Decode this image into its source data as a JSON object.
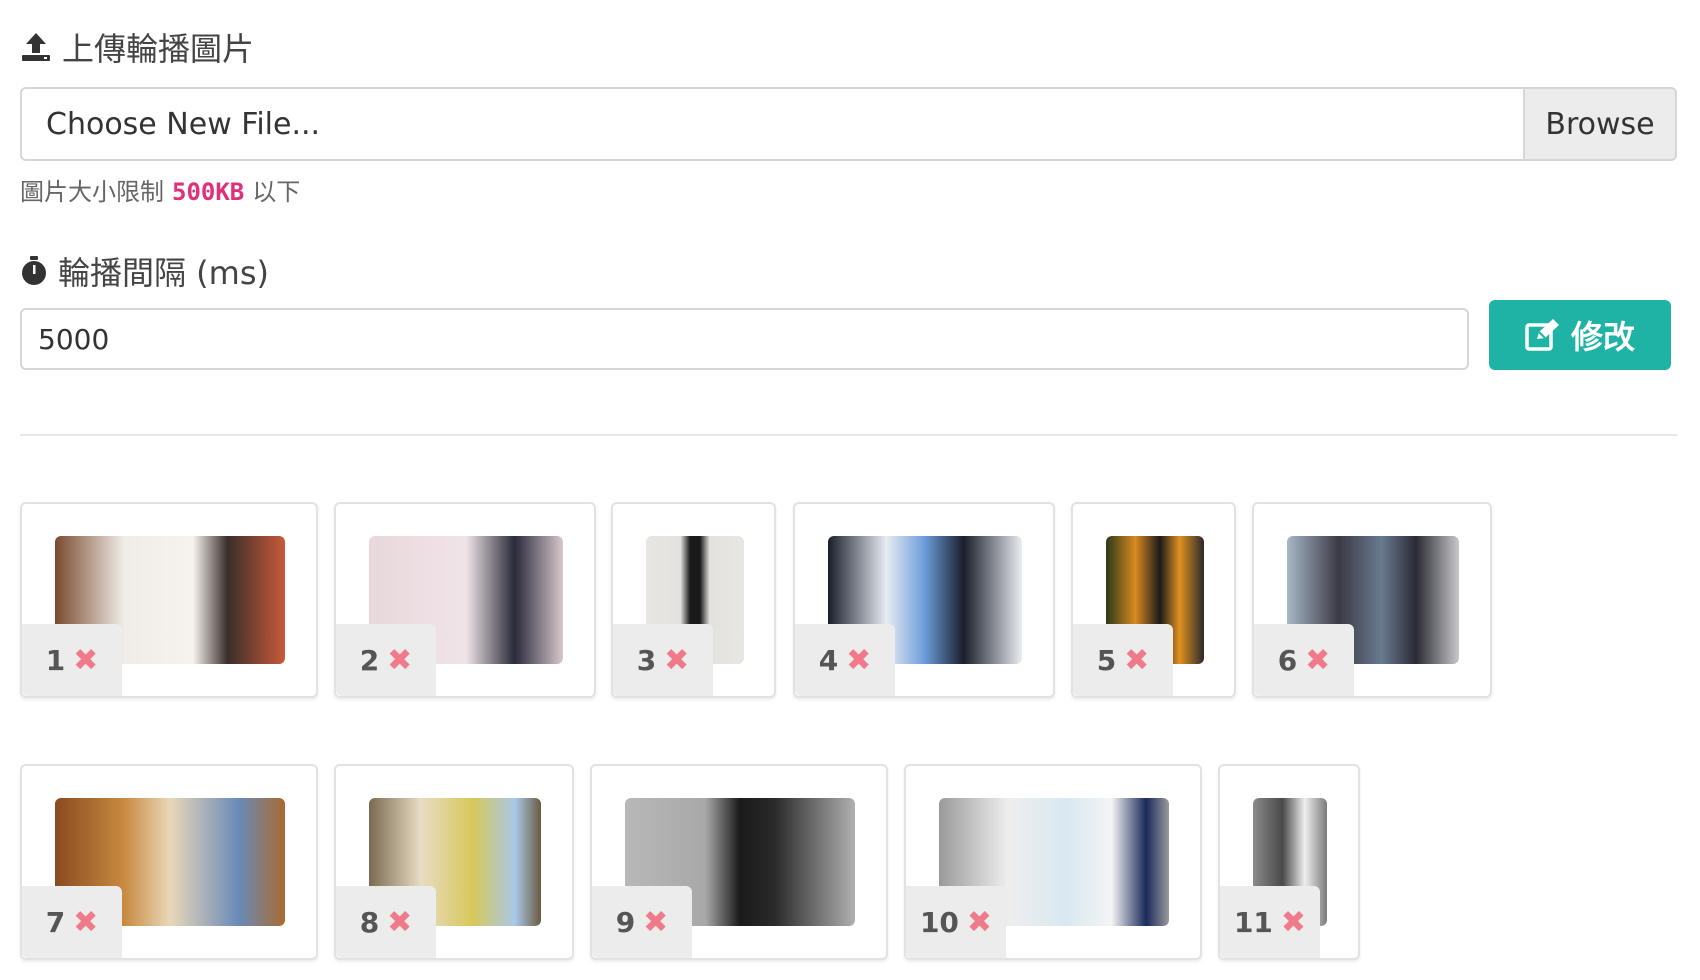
{
  "upload": {
    "title": "上傳輪播圖片",
    "icon": "upload-icon",
    "file_placeholder": "Choose New File...",
    "browse_label": "Browse",
    "help_prefix": "圖片大小限制",
    "help_limit": "500KB",
    "help_suffix": "以下"
  },
  "interval": {
    "title": "輪播間隔 (ms)",
    "icon": "stopwatch-icon",
    "value": "5000",
    "submit_label": "修改",
    "submit_icon": "edit-icon",
    "accent_color": "#1fb3a5"
  },
  "slides": [
    {
      "index": "1"
    },
    {
      "index": "2"
    },
    {
      "index": "3"
    },
    {
      "index": "4"
    },
    {
      "index": "5"
    },
    {
      "index": "6"
    },
    {
      "index": "7"
    },
    {
      "index": "8"
    },
    {
      "index": "9"
    },
    {
      "index": "10"
    },
    {
      "index": "11"
    }
  ],
  "remove_icon": "close-icon"
}
